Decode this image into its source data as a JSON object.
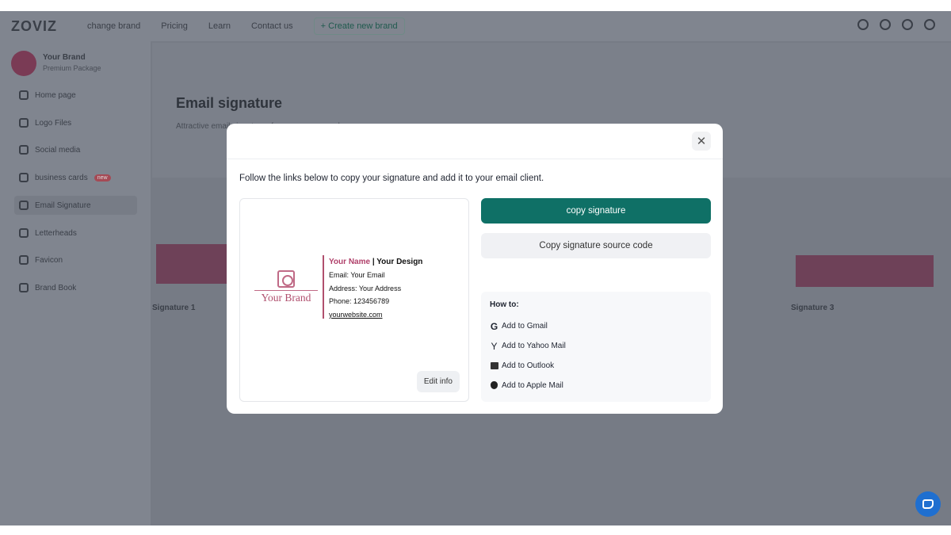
{
  "topbar": {
    "logo": "ZOVIZ",
    "nav": [
      "change brand",
      "Pricing",
      "Learn",
      "Contact us"
    ],
    "create": "+ Create new brand"
  },
  "sidebar": {
    "brand_name": "Your Brand",
    "brand_plan": "Premium Package",
    "items": [
      {
        "label": "Home page"
      },
      {
        "label": "Logo Files"
      },
      {
        "label": "Social media"
      },
      {
        "label": "business cards",
        "badge": "new"
      },
      {
        "label": "Email Signature"
      },
      {
        "label": "Letterheads"
      },
      {
        "label": "Favicon"
      },
      {
        "label": "Brand Book"
      }
    ]
  },
  "hero": {
    "title": "Email signature",
    "desc": "Attractive email signatures for your correspondence"
  },
  "background": {
    "sig1": "Signature 1",
    "sig3": "Signature 3"
  },
  "modal": {
    "intro": "Follow the links below to copy your signature and add it to your email client.",
    "preview": {
      "brand": "Your Brand",
      "name": "Your Name",
      "separator": " | ",
      "design": "Your Design",
      "email_label": "Email: ",
      "email": "Your Email",
      "address_label": "Address: ",
      "address": "Your Address",
      "phone_label": "Phone: ",
      "phone": "123456789",
      "website": "yourwebsite.com",
      "accent": "#b0406a"
    },
    "edit_label": "Edit info",
    "copy_label": "copy signature",
    "copy_source_label": "Copy signature source code",
    "primary_color": "#0f7066",
    "howto": {
      "title": "How to:",
      "items": [
        {
          "label": "Add to Gmail",
          "icon": "google-icon"
        },
        {
          "label": "Add to Yahoo Mail",
          "icon": "yahoo-icon"
        },
        {
          "label": "Add to Outlook",
          "icon": "outlook-icon"
        },
        {
          "label": "Add to Apple Mail",
          "icon": "apple-icon"
        }
      ]
    }
  }
}
